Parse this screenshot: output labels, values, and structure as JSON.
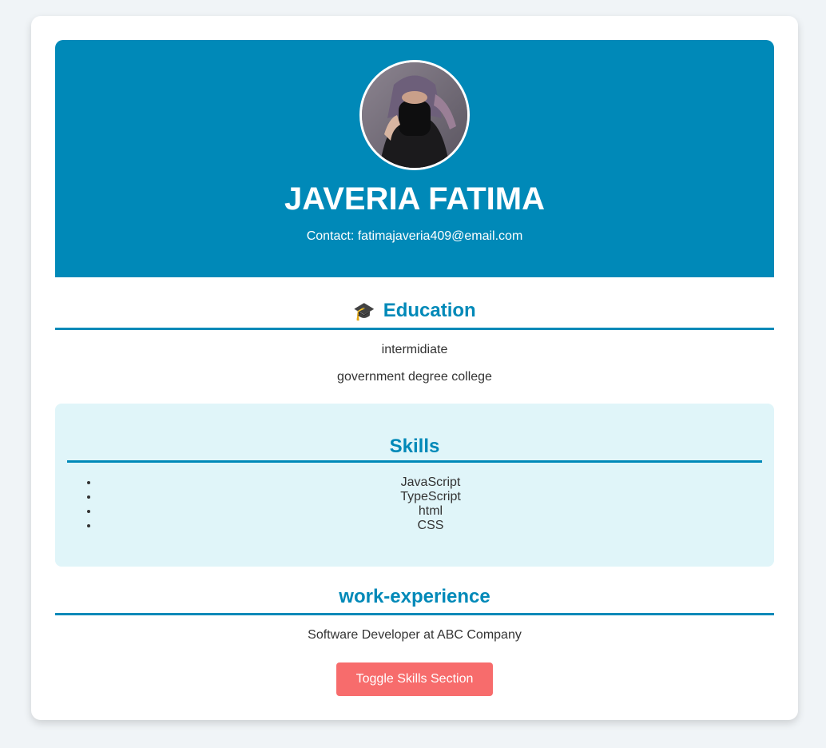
{
  "header": {
    "name": "JAVERIA FATIMA",
    "contact": "Contact: fatimajaveria409@email.com",
    "background_color": "#0089b8",
    "avatar_icon": "profile-photo"
  },
  "education": {
    "icon": "graduation-cap-icon",
    "icon_glyph": "🎓",
    "title": "Education",
    "items": [
      "intermidiate",
      "government degree college"
    ]
  },
  "skills": {
    "title": "Skills",
    "items": [
      "JavaScript",
      "TypeScript",
      "html",
      "CSS"
    ],
    "background_color": "#e0f5f9"
  },
  "work": {
    "title": "work-experience",
    "items": [
      "Software Developer at ABC Company"
    ]
  },
  "actions": {
    "toggle_label": "Toggle Skills Section",
    "toggle_color": "#f76c6c"
  },
  "theme": {
    "accent": "#0089b8",
    "page_background": "#f0f4f7"
  }
}
